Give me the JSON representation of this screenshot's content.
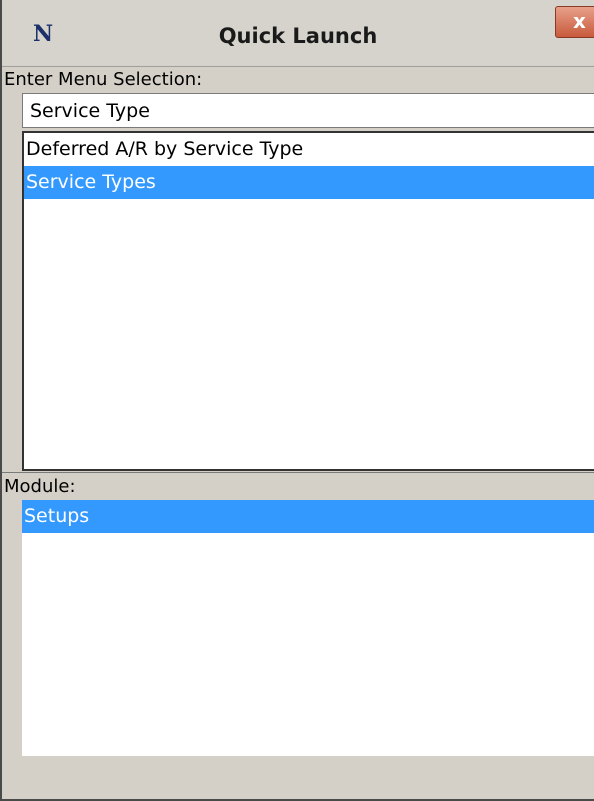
{
  "window": {
    "title": "Quick Launch",
    "app_icon": "N",
    "close_label": "x"
  },
  "menu_selection": {
    "label": "Enter Menu Selection:",
    "input_value": "Service Type",
    "results": [
      {
        "label": "Deferred A/R by Service Type",
        "selected": false
      },
      {
        "label": "Service Types",
        "selected": true
      }
    ]
  },
  "module": {
    "label": "Module:",
    "items": [
      {
        "label": "Setups",
        "selected": true
      }
    ]
  },
  "colors": {
    "selection": "#3399ff",
    "chrome": "#d4d0c8",
    "close_button": "#c85a3c"
  },
  "icons": [
    "app-logo-icon",
    "close-icon"
  ]
}
